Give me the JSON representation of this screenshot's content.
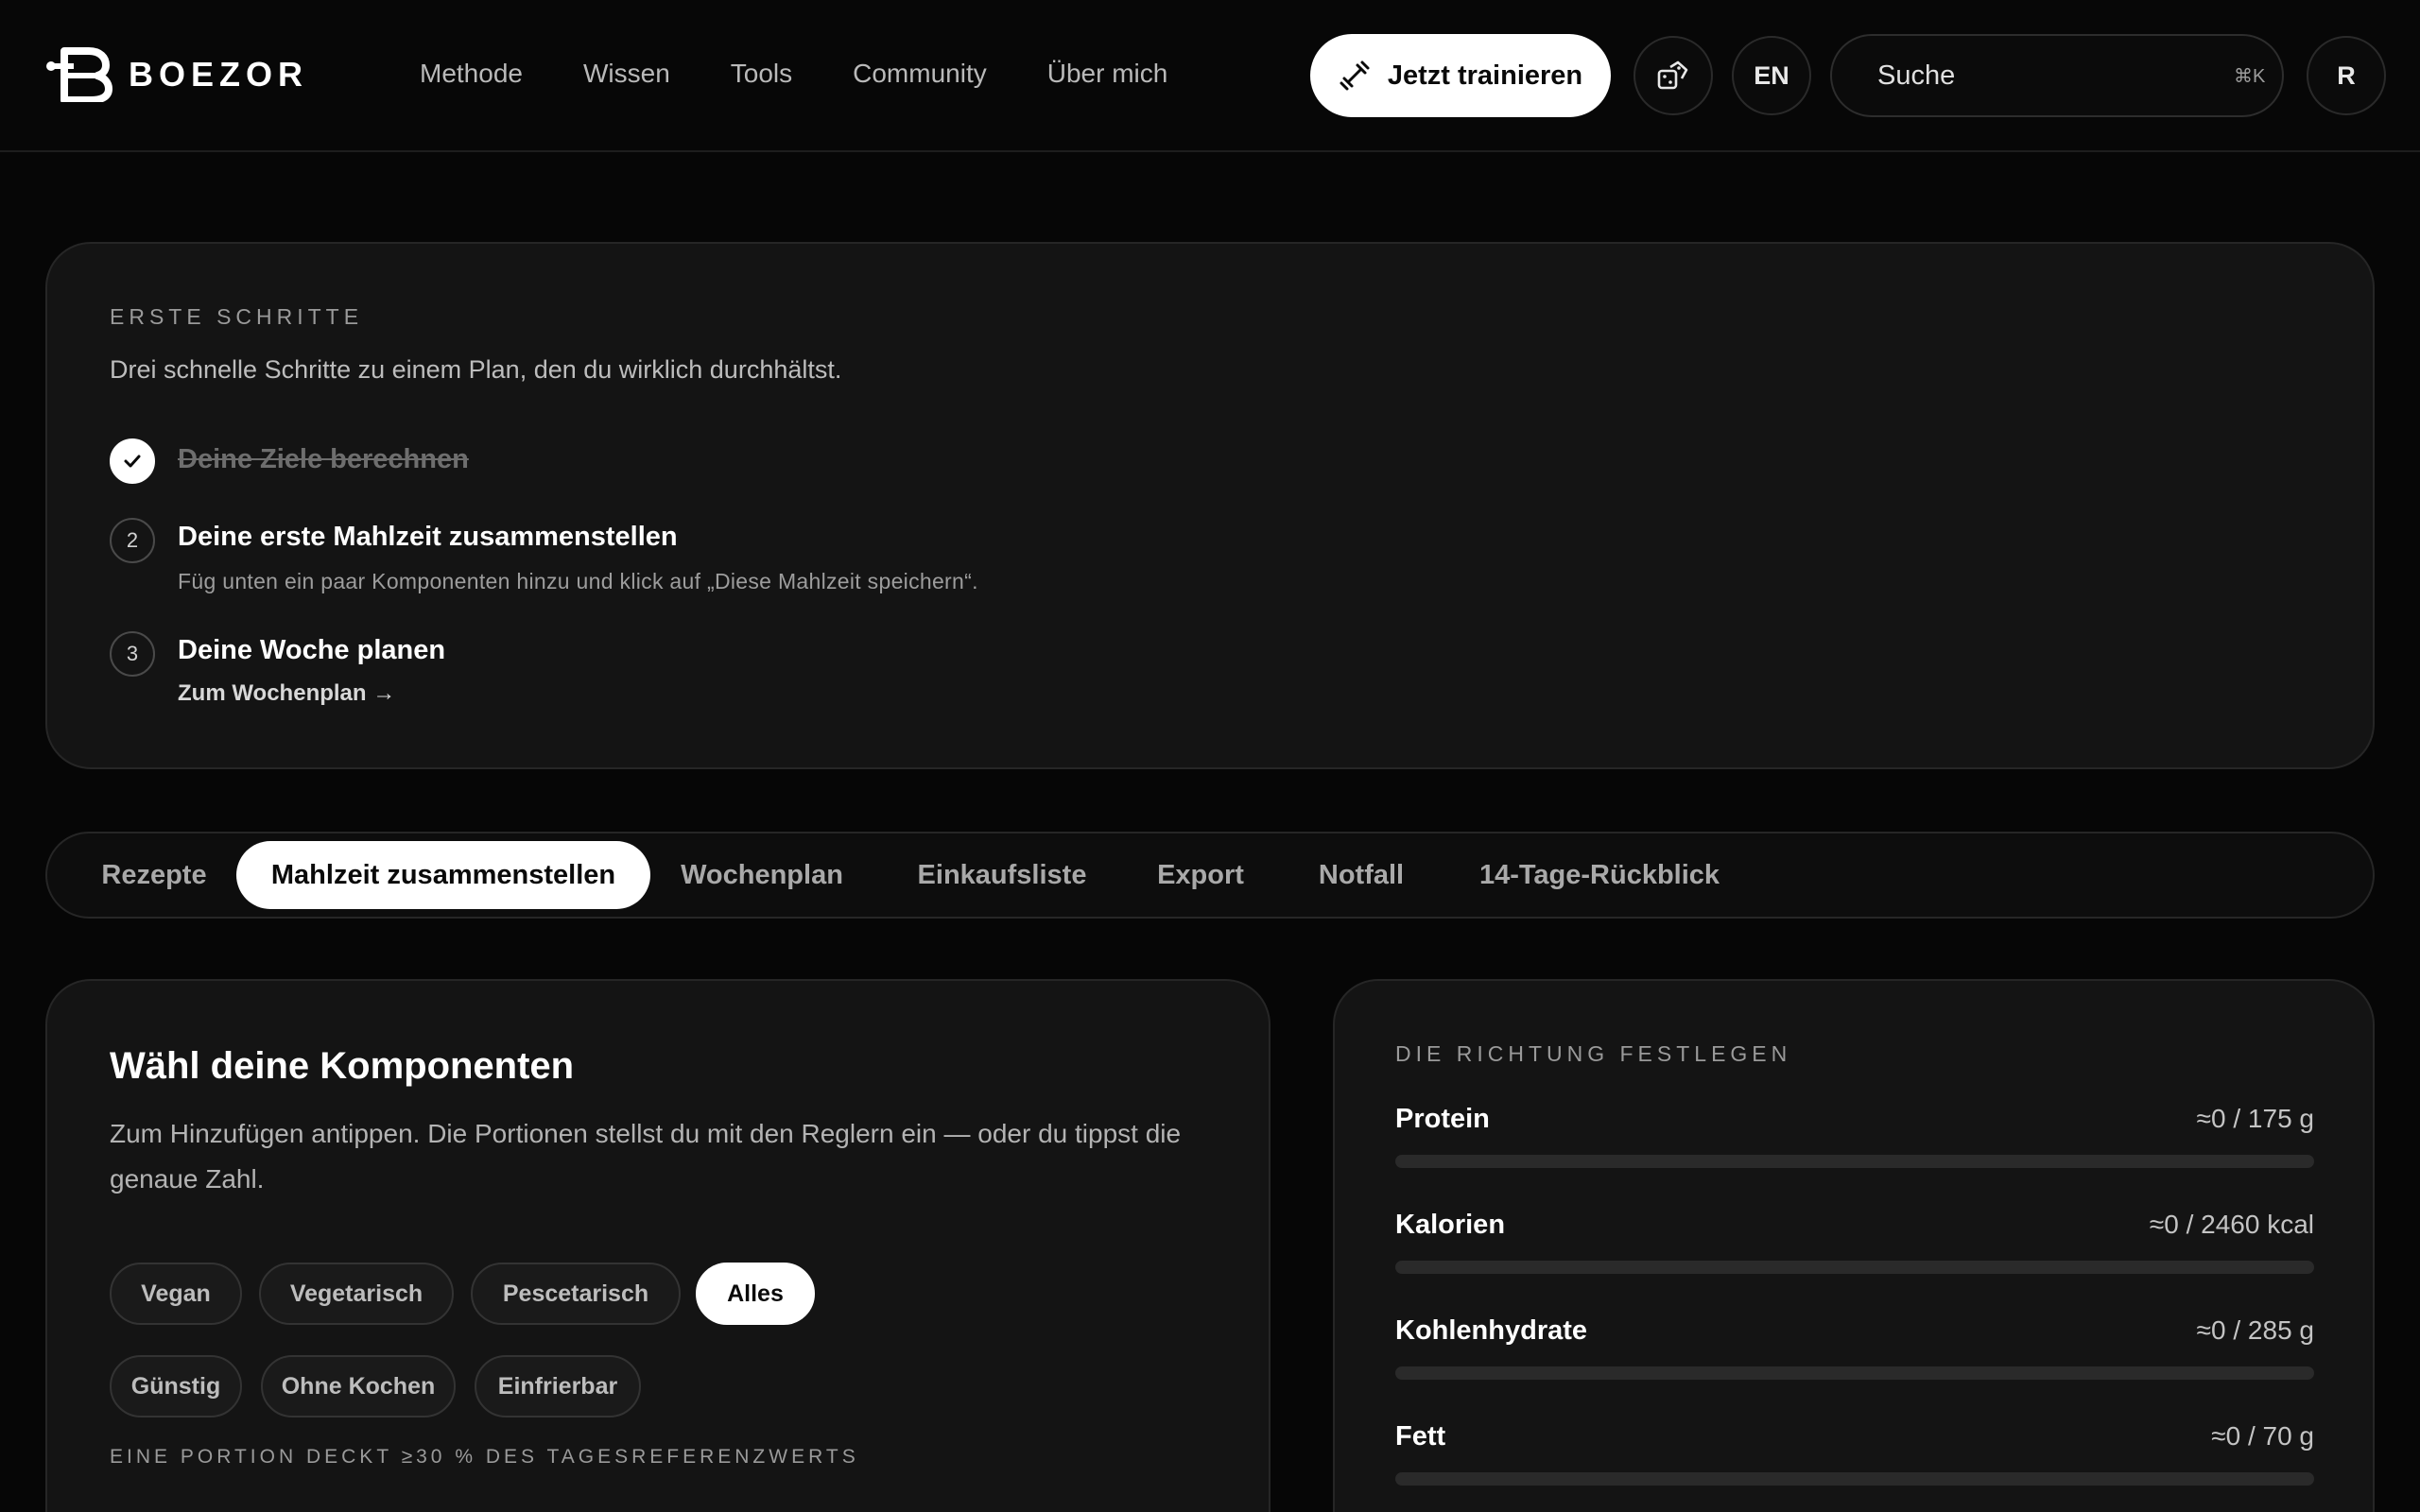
{
  "header": {
    "brand": "BOEZOR",
    "nav": [
      "Methode",
      "Wissen",
      "Tools",
      "Community",
      "Über mich"
    ],
    "cta_label": "Jetzt trainieren",
    "lang_label": "EN",
    "search": {
      "placeholder": "Suche",
      "shortcut": "⌘K"
    },
    "avatar_initial": "R"
  },
  "getting_started": {
    "eyebrow": "ERSTE SCHRITTE",
    "subtitle": "Drei schnelle Schritte zu einem Plan, den du wirklich durchhältst.",
    "steps": [
      {
        "marker": "✓",
        "title": "Deine Ziele berechnen",
        "done": true
      },
      {
        "marker": "2",
        "title": "Deine erste Mahlzeit zusammenstellen",
        "hint": "Füg unten ein paar Komponenten hinzu und klick auf „Diese Mahlzeit speichern“.",
        "done": false
      },
      {
        "marker": "3",
        "title": "Deine Woche planen",
        "link": "Zum Wochenplan →",
        "done": false
      }
    ]
  },
  "tabs": [
    {
      "label": "Rezepte",
      "active": false
    },
    {
      "label": "Mahlzeit zusammenstellen",
      "active": true
    },
    {
      "label": "Wochenplan",
      "active": false
    },
    {
      "label": "Einkaufsliste",
      "active": false
    },
    {
      "label": "Export",
      "active": false
    },
    {
      "label": "Notfall",
      "active": false
    },
    {
      "label": "14-Tage-Rückblick",
      "active": false
    }
  ],
  "components": {
    "title": "Wähl deine Komponenten",
    "description": "Zum Hinzufügen antippen. Die Portionen stellst du mit den Reglern ein — oder du tippst die genaue Zahl.",
    "diet_filters": [
      {
        "label": "Vegan",
        "active": false
      },
      {
        "label": "Vegetarisch",
        "active": false
      },
      {
        "label": "Pescetarisch",
        "active": false
      },
      {
        "label": "Alles",
        "active": true
      }
    ],
    "extra_filters": [
      {
        "label": "Günstig",
        "active": false
      },
      {
        "label": "Ohne Kochen",
        "active": false
      },
      {
        "label": "Einfrierbar",
        "active": false
      }
    ],
    "coverage_eyebrow": "EINE PORTION DECKT ≥30 % DES TAGESREFERENZWERTS"
  },
  "direction": {
    "eyebrow": "DIE RICHTUNG FESTLEGEN",
    "macros": [
      {
        "label": "Protein",
        "value_text": "≈0 / 175 g",
        "progress": 0
      },
      {
        "label": "Kalorien",
        "value_text": "≈0 / 2460 kcal",
        "progress": 0
      },
      {
        "label": "Kohlenhydrate",
        "value_text": "≈0 / 285 g",
        "progress": 0
      },
      {
        "label": "Fett",
        "value_text": "≈0 / 70 g",
        "progress": 0
      }
    ]
  },
  "colors": {
    "accent": "#ffffff",
    "background": "#060606",
    "card": "#141414"
  }
}
